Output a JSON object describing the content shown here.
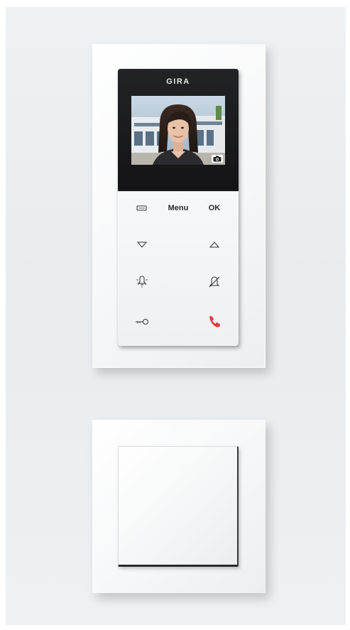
{
  "intercom": {
    "brand": "GIRA",
    "screen": {
      "content": "video-feed-person",
      "badge_icon": "camera-icon"
    },
    "keys": {
      "row1": {
        "left_icon": "message-icon",
        "menu_label": "Menu",
        "ok_label": "OK"
      },
      "row2": {
        "left_icon": "arrow-down-icon",
        "right_icon": "arrow-up-icon"
      },
      "row3": {
        "left_icon": "light-icon",
        "right_icon": "bell-off-icon"
      },
      "row4": {
        "left_icon": "key-icon",
        "right_icon": "phone-icon"
      }
    },
    "colors": {
      "phone_accent": "#e23a3a",
      "device_dark": "#1a1a1c",
      "keypad": "#f2f3f4"
    }
  },
  "switch": {
    "type": "rocker-switch"
  }
}
